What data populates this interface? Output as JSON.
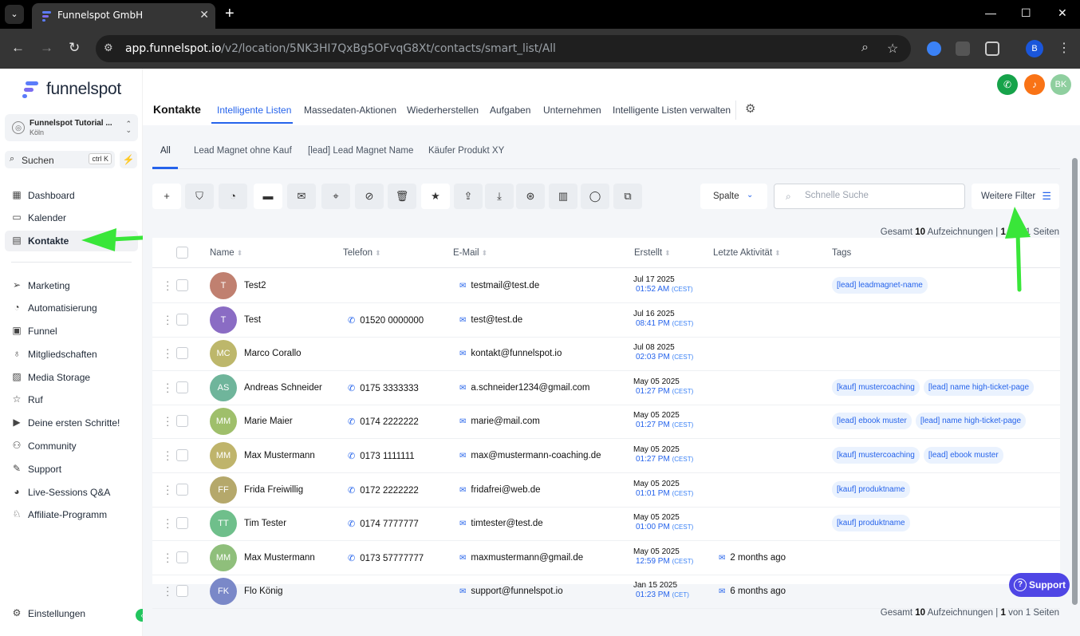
{
  "browser": {
    "tab_title": "Funnelspot GmbH",
    "url_host": "app.funnelspot.io",
    "url_path": "/v2/location/5NK3HI7QxBg5OFvqG8Xt/contacts/smart_list/All",
    "profile_initial": "B"
  },
  "sidebar": {
    "logo_text": "funnelspot",
    "account_name": "Funnelspot Tutorial ...",
    "account_sub": "Köln",
    "search_label": "Suchen",
    "search_shortcut": "ctrl K",
    "items": [
      {
        "label": "Dashboard",
        "icon": "dashboard-icon"
      },
      {
        "label": "Kalender",
        "icon": "calendar-icon"
      },
      {
        "label": "Kontakte",
        "icon": "contacts-icon"
      },
      {
        "label": "Marketing",
        "icon": "send-icon"
      },
      {
        "label": "Automatisierung",
        "icon": "automation-icon"
      },
      {
        "label": "Funnel",
        "icon": "funnel-icon"
      },
      {
        "label": "Mitgliedschaften",
        "icon": "membership-icon"
      },
      {
        "label": "Media Storage",
        "icon": "image-icon"
      },
      {
        "label": "Ruf",
        "icon": "star-icon"
      },
      {
        "label": "Deine ersten Schritte!",
        "icon": "play-icon"
      },
      {
        "label": "Community",
        "icon": "community-icon"
      },
      {
        "label": "Support",
        "icon": "wrench-icon"
      },
      {
        "label": "Live-Sessions Q&A",
        "icon": "chat-icon"
      },
      {
        "label": "Affiliate-Programm",
        "icon": "affiliate-icon"
      }
    ],
    "settings_label": "Einstellungen"
  },
  "header": {
    "user_initials": "BK",
    "page_title": "Kontakte",
    "tabs": [
      "Intelligente Listen",
      "Massedaten-Aktionen",
      "Wiederherstellen",
      "Aufgaben",
      "Unternehmen",
      "Intelligente Listen verwalten"
    ]
  },
  "subtabs": [
    "All",
    "Lead Magnet ohne Kauf",
    "[lead] Lead Magnet Name",
    "Käufer Produkt XY"
  ],
  "toolbar": {
    "columns_label": "Spalte",
    "search_placeholder": "Schnelle Suche",
    "more_filters_label": "Weitere Filter"
  },
  "totals_top": {
    "prefix": "Gesamt",
    "count": "10",
    "mid": "Aufzeichnungen |",
    "page": "1",
    "suffix": "von 1 Seiten"
  },
  "totals_bottom": {
    "prefix": "Gesamt",
    "count": "10",
    "mid": "Aufzeichnungen |",
    "page": "1",
    "suffix": "von 1 Seiten"
  },
  "table": {
    "columns": [
      "Name",
      "Telefon",
      "E-Mail",
      "Erstellt",
      "Letzte Aktivität",
      "Tags"
    ],
    "rows": [
      {
        "initials": "T",
        "color": "#c08070",
        "name": "Test2",
        "phone": "",
        "email": "testmail@test.de",
        "date": "Jul 17 2025",
        "time": "01:52 AM",
        "tz": "(CEST)",
        "activity": "",
        "tags": [
          "[lead] leadmagnet-name"
        ]
      },
      {
        "initials": "T",
        "color": "#8a6cc4",
        "name": "Test",
        "phone": "01520 0000000",
        "email": "test@test.de",
        "date": "Jul 16 2025",
        "time": "08:41 PM",
        "tz": "(CEST)",
        "activity": "",
        "tags": []
      },
      {
        "initials": "MC",
        "color": "#bdb76b",
        "name": "Marco Corallo",
        "phone": "",
        "email": "kontakt@funnelspot.io",
        "date": "Jul 08 2025",
        "time": "02:03 PM",
        "tz": "(CEST)",
        "activity": "",
        "tags": []
      },
      {
        "initials": "AS",
        "color": "#6fb59b",
        "name": "Andreas Schneider",
        "phone": "0175 3333333",
        "email": "a.schneider1234@gmail.com",
        "date": "May 05 2025",
        "time": "01:27 PM",
        "tz": "(CEST)",
        "activity": "",
        "tags": [
          "[kauf] mustercoaching",
          "[lead] name high-ticket-page"
        ]
      },
      {
        "initials": "MM",
        "color": "#9fbf6b",
        "name": "Marie Maier",
        "phone": "0174 2222222",
        "email": "marie@mail.com",
        "date": "May 05 2025",
        "time": "01:27 PM",
        "tz": "(CEST)",
        "activity": "",
        "tags": [
          "[lead] ebook muster",
          "[lead] name high-ticket-page"
        ]
      },
      {
        "initials": "MM",
        "color": "#bfb46b",
        "name": "Max Mustermann",
        "phone": "0173 1111111",
        "email": "max@mustermann-coaching.de",
        "date": "May 05 2025",
        "time": "01:27 PM",
        "tz": "(CEST)",
        "activity": "",
        "tags": [
          "[kauf] mustercoaching",
          "[lead] ebook muster"
        ]
      },
      {
        "initials": "FF",
        "color": "#b5a86b",
        "name": "Frida Freiwillig",
        "phone": "0172 2222222",
        "email": "fridafrei@web.de",
        "date": "May 05 2025",
        "time": "01:01 PM",
        "tz": "(CEST)",
        "activity": "",
        "tags": [
          "[kauf] produktname"
        ]
      },
      {
        "initials": "TT",
        "color": "#6fbf8b",
        "name": "Tim Tester",
        "phone": "0174 7777777",
        "email": "timtester@test.de",
        "date": "May 05 2025",
        "time": "01:00 PM",
        "tz": "(CEST)",
        "activity": "",
        "tags": [
          "[kauf] produktname"
        ]
      },
      {
        "initials": "MM",
        "color": "#8fbf7b",
        "name": "Max Mustermann",
        "phone": "0173 57777777",
        "email": "maxmustermann@gmail.de",
        "date": "May 05 2025",
        "time": "12:59 PM",
        "tz": "(CEST)",
        "activity": "2 months ago",
        "tags": []
      },
      {
        "initials": "FK",
        "color": "#7a88c8",
        "name": "Flo König",
        "phone": "",
        "email": "support@funnelspot.io",
        "date": "Jan 15 2025",
        "time": "01:23 PM",
        "tz": "(CET)",
        "activity": "6 months ago",
        "tags": []
      }
    ]
  },
  "support_button_label": "Support"
}
